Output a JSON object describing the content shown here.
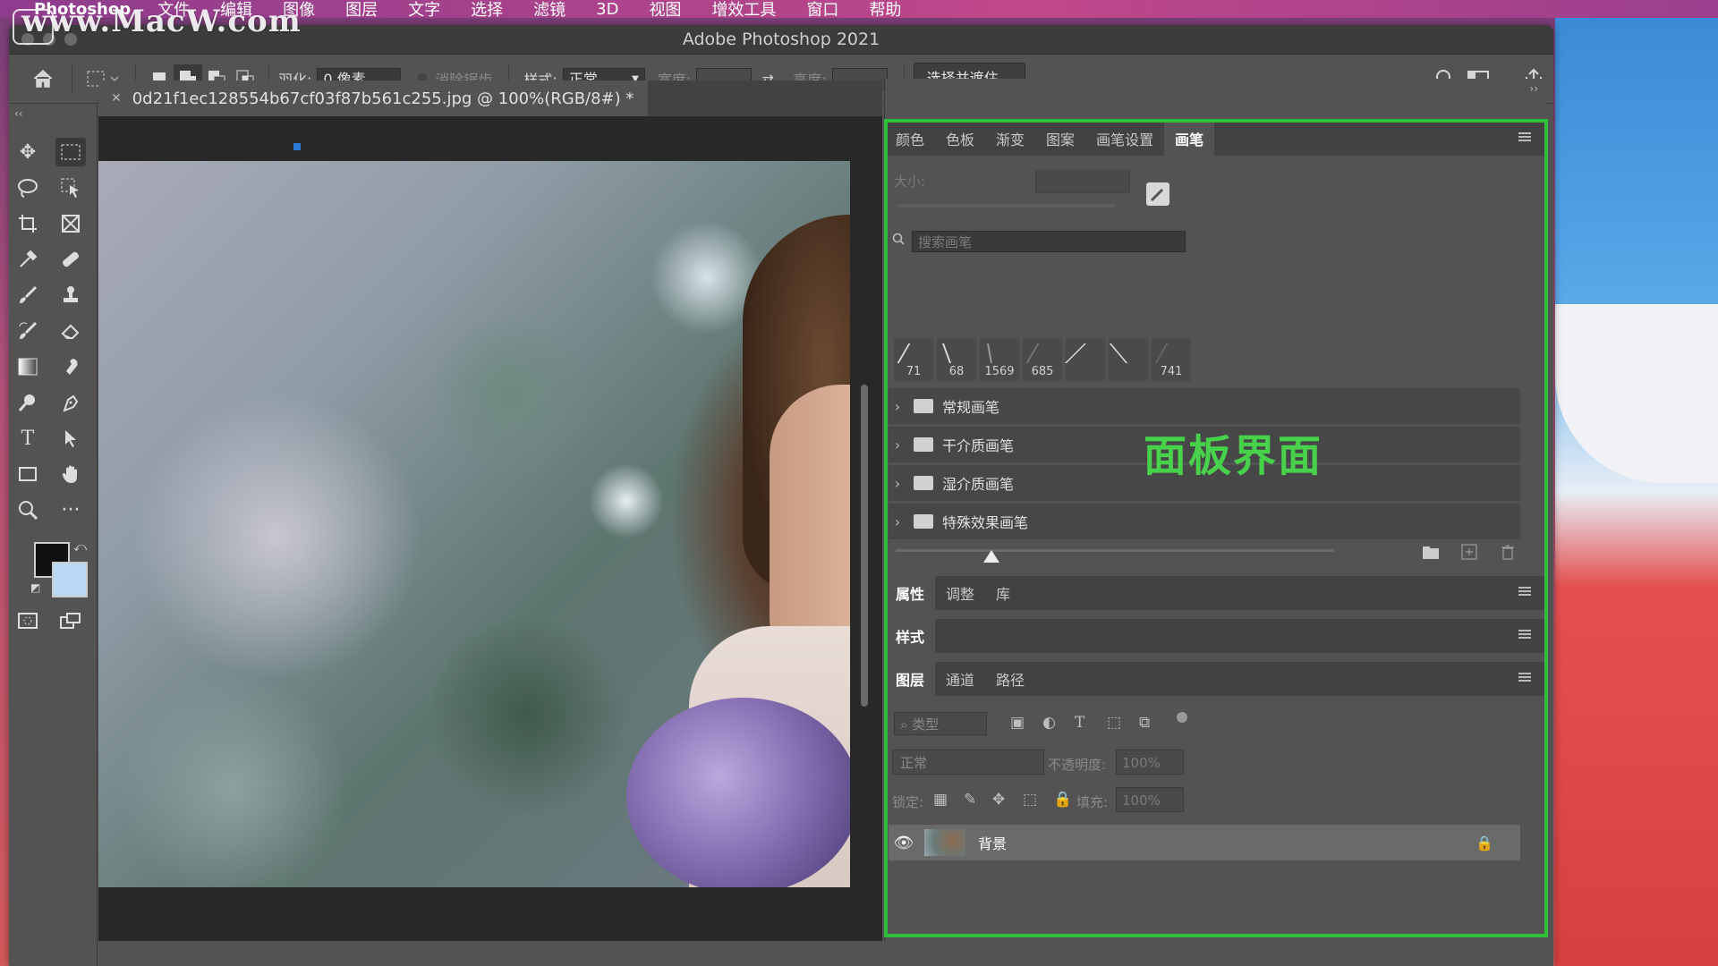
{
  "menubar": {
    "app": "Photoshop",
    "items": [
      "文件",
      "编辑",
      "图像",
      "图层",
      "文字",
      "选择",
      "滤镜",
      "3D",
      "视图",
      "增效工具",
      "窗口",
      "帮助"
    ]
  },
  "watermark": "www.MacW.com",
  "window": {
    "title": "Adobe Photoshop 2021"
  },
  "options": {
    "feather_label": "羽化:",
    "feather_value": "0 像素",
    "antialias_label": "消除锯齿",
    "style_label": "样式:",
    "style_value": "正常",
    "width_label": "宽度:",
    "height_label": "高度:",
    "select_mask_button": "选择并遮住..."
  },
  "document": {
    "tab_title": "0d21f1ec128554b67cf03f87b561c255.jpg @ 100%(RGB/8#) *"
  },
  "brush_panel": {
    "tabs": [
      "颜色",
      "色板",
      "渐变",
      "图案",
      "画笔设置",
      "画笔"
    ],
    "active_tab": "画笔",
    "size_label": "大小:",
    "search_placeholder": "搜索画笔",
    "presets": [
      "71",
      "68",
      "1569",
      "685",
      "",
      "",
      "741"
    ],
    "groups": [
      "常规画笔",
      "干介质画笔",
      "湿介质画笔",
      "特殊效果画笔"
    ]
  },
  "properties_panel": {
    "tabs": [
      "属性",
      "调整",
      "库"
    ]
  },
  "styles_panel": {
    "title": "样式"
  },
  "layers_panel": {
    "tabs": [
      "图层",
      "通道",
      "路径"
    ],
    "filter_label": "类型",
    "blend_mode": "正常",
    "opacity_label": "不透明度:",
    "opacity_value": "100%",
    "lock_label": "锁定:",
    "fill_label": "填充:",
    "fill_value": "100%",
    "layers": [
      {
        "name": "背景",
        "locked": true
      }
    ]
  },
  "annotation": "面板界面",
  "colors": {
    "highlight_box": "#2fbf3a",
    "panel_bg": "#535353"
  }
}
